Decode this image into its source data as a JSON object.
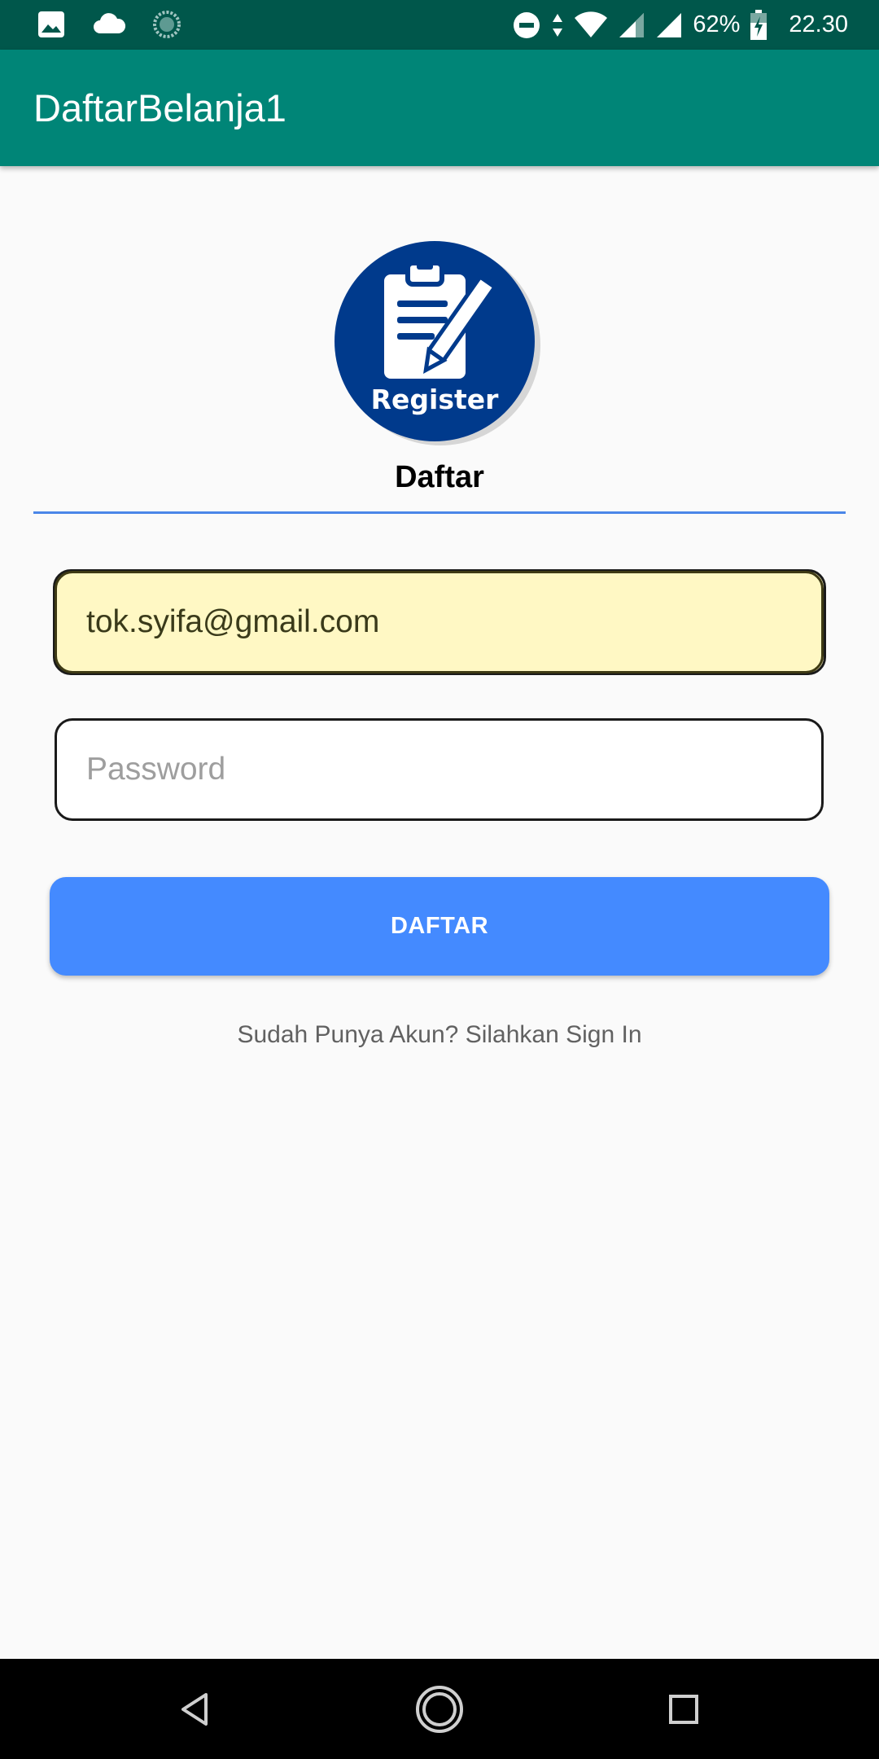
{
  "status_bar": {
    "battery_percent": "62%",
    "time": "22.30",
    "left_icons": [
      "image-icon",
      "cloud-icon",
      "sync-icon"
    ],
    "right_icons": [
      "do-not-disturb-icon",
      "data-arrows-icon",
      "wifi-icon",
      "signal-icon",
      "signal-icon",
      "battery-charging-icon"
    ]
  },
  "app_bar": {
    "title": "DaftarBelanja1"
  },
  "logo": {
    "caption": "Register",
    "icon": "clipboard-pencil-icon",
    "color": "#003a8c"
  },
  "form": {
    "heading": "Daftar",
    "email_value": "tok.syifa@gmail.com",
    "password_placeholder": "Password",
    "submit_label": "DAFTAR",
    "signin_text": "Sudah Punya Akun? Silahkan Sign In"
  },
  "colors": {
    "status_bar": "#00574b",
    "app_bar": "#008577",
    "button": "#448aff",
    "autofill": "#fff8c4",
    "underline": "#4a86e8"
  },
  "nav_bar": {
    "icons": [
      "back-icon",
      "home-icon",
      "recent-apps-icon"
    ]
  }
}
